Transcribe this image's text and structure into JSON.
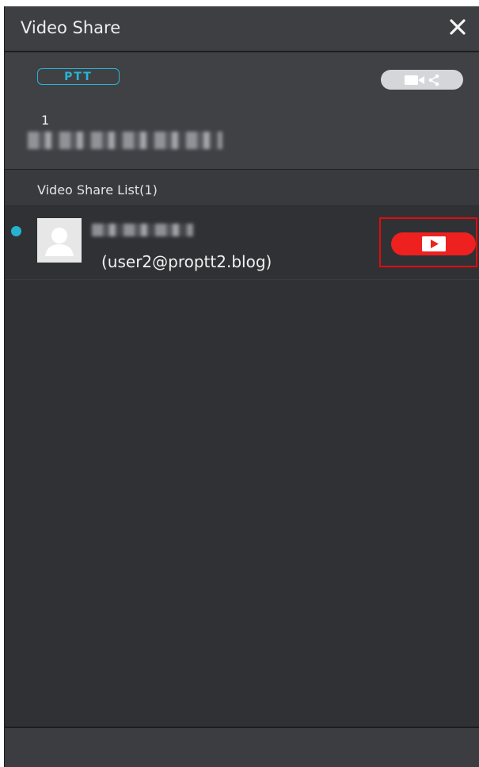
{
  "window": {
    "title": "Video Share",
    "close_icon": "close-icon"
  },
  "user_panel": {
    "ptt_label": "PTT",
    "video_share_icon": "video-share-icon",
    "user_number": "1"
  },
  "video_share_list": {
    "header": "Video Share List(1)",
    "items": [
      {
        "status_color": "#26b2d1",
        "avatar_icon": "user-avatar-icon",
        "email": "(user2@proptt2.blog)",
        "action_icon": "play-icon"
      }
    ]
  },
  "colors": {
    "accent": "#27b4d6",
    "play_button": "#ee2020",
    "highlight_border": "#e00c0c"
  }
}
